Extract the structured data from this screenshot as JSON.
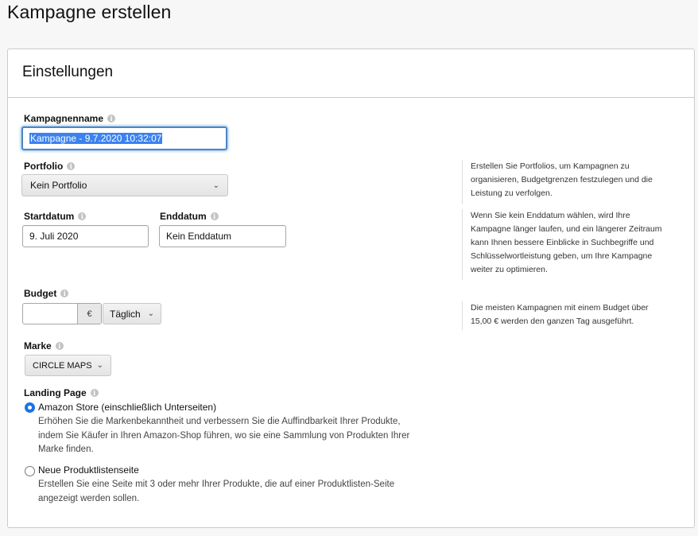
{
  "page": {
    "title": "Kampagne erstellen"
  },
  "settings": {
    "title": "Einstellungen",
    "campaign_name": {
      "label": "Kampagnenname",
      "value": "Kampagne - 9.7.2020 10:32:07"
    },
    "portfolio": {
      "label": "Portfolio",
      "selected": "Kein Portfolio",
      "help": [
        "Erstellen Sie Portfolios, um Kampagnen zu",
        "organisieren, Budgetgrenzen festzulegen und die",
        "Leistung zu verfolgen."
      ]
    },
    "dates": {
      "start_label": "Startdatum",
      "start_value": "9. Juli 2020",
      "end_label": "Enddatum",
      "end_value": "Kein Enddatum",
      "help": [
        "Wenn Sie kein Enddatum wählen, wird Ihre",
        "Kampagne länger laufen, und ein längerer Zeitraum",
        "kann Ihnen bessere Einblicke in Suchbegriffe und",
        "Schlüsselwortleistung geben, um Ihre Kampagne",
        "weiter zu optimieren."
      ]
    },
    "budget": {
      "label": "Budget",
      "value": "",
      "currency": "€",
      "period": "Täglich",
      "help": [
        "Die meisten Kampagnen mit einem Budget über",
        "15,00 € werden den ganzen Tag ausgeführt."
      ]
    },
    "brand": {
      "label": "Marke",
      "selected": "CIRCLE MAPS"
    },
    "landing_page": {
      "label": "Landing Page",
      "options": [
        {
          "title": "Amazon Store (einschließlich Unterseiten)",
          "checked": true,
          "desc": [
            "Erhöhen Sie die Markenbekanntheit und verbessern Sie die Auffindbarkeit Ihrer Produkte,",
            "indem Sie Käufer in Ihren Amazon-Shop führen, wo sie eine Sammlung von Produkten Ihrer",
            "Marke finden."
          ]
        },
        {
          "title": "Neue Produktlistenseite",
          "checked": false,
          "desc": [
            "Erstellen Sie eine Seite mit 3 oder mehr Ihrer Produkte, die auf einer Produktlisten-Seite",
            "angezeigt werden sollen."
          ]
        }
      ]
    }
  }
}
